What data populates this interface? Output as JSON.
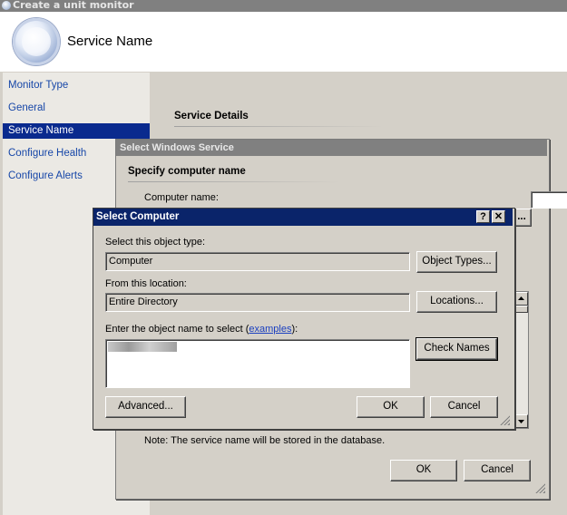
{
  "outer": {
    "title": "Create a unit monitor",
    "header_title": "Service Name"
  },
  "nav": {
    "items": [
      {
        "label": "Monitor Type"
      },
      {
        "label": "General"
      },
      {
        "label": "Service Name"
      },
      {
        "label": "Configure Health"
      },
      {
        "label": "Configure Alerts"
      }
    ],
    "active": "Service Name"
  },
  "main": {
    "section_heading": "Service Details"
  },
  "select_windows_service": {
    "title": "Select Windows Service",
    "heading": "Specify computer name",
    "computer_name_label": "Computer name:",
    "browse_label": "...",
    "note": "Note: The service name will be stored in the database.",
    "ok_label": "OK",
    "cancel_label": "Cancel"
  },
  "select_computer": {
    "title": "Select Computer",
    "help_label": "?",
    "close_label": "✕",
    "object_type_label": "Select this object type:",
    "object_type_value": "Computer",
    "object_types_button": "Object Types...",
    "location_label": "From this location:",
    "location_value": "Entire Directory",
    "locations_button": "Locations...",
    "enter_name_label": "Enter the object name to select (",
    "examples_link": "examples",
    "enter_name_suffix": "):",
    "check_names_button": "Check Names",
    "advanced_button": "Advanced...",
    "ok_label": "OK",
    "cancel_label": "Cancel"
  }
}
